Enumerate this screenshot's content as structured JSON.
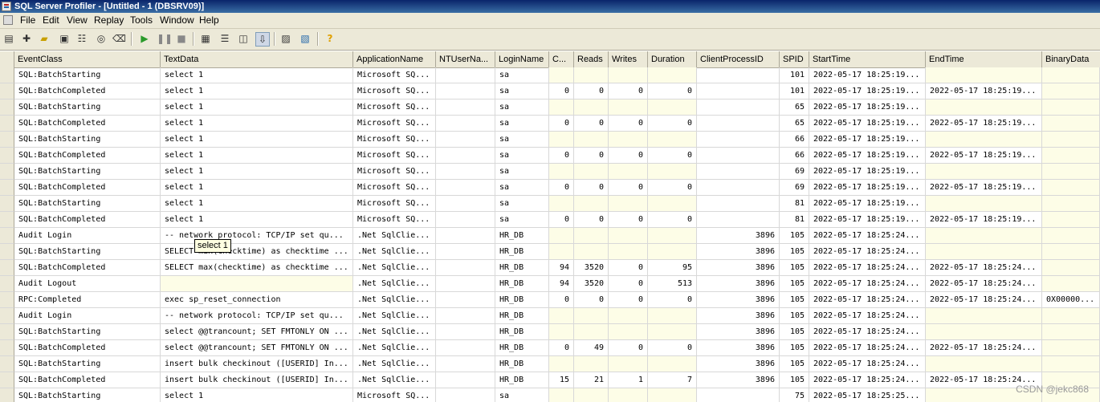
{
  "window": {
    "title": "SQL Server Profiler - [Untitled - 1 (DBSRV09)]"
  },
  "menu": [
    "File",
    "Edit",
    "View",
    "Replay",
    "Tools",
    "Window",
    "Help"
  ],
  "toolbar": {
    "icons": [
      "new-trace-icon",
      "new-template-icon",
      "open-icon",
      "save-icon",
      "properties-icon",
      "find-icon",
      "clear-trace-icon",
      "run-icon",
      "pause-icon",
      "stop-icon",
      "grid-view-icon",
      "columns-icon",
      "group-icon",
      "auto-scroll-icon",
      "activity-monitor-icon",
      "performance-monitor-icon",
      "help-icon"
    ]
  },
  "columns": [
    "EventClass",
    "TextData",
    "ApplicationName",
    "NTUserNa...",
    "LoginName",
    "C...",
    "Reads",
    "Writes",
    "Duration",
    "ClientProcessID",
    "SPID",
    "StartTime",
    "EndTime",
    "BinaryData"
  ],
  "rows": [
    [
      "SQL:BatchStarting",
      "select 1",
      "Microsoft SQ...",
      "",
      "sa",
      "",
      "",
      "",
      "",
      "",
      "101",
      "2022-05-17 18:25:19...",
      "",
      ""
    ],
    [
      "SQL:BatchCompleted",
      "select 1",
      "Microsoft SQ...",
      "",
      "sa",
      "0",
      "0",
      "0",
      "0",
      "",
      "101",
      "2022-05-17 18:25:19...",
      "2022-05-17 18:25:19...",
      ""
    ],
    [
      "SQL:BatchStarting",
      "select 1",
      "Microsoft SQ...",
      "",
      "sa",
      "",
      "",
      "",
      "",
      "",
      "65",
      "2022-05-17 18:25:19...",
      "",
      ""
    ],
    [
      "SQL:BatchCompleted",
      "select 1",
      "Microsoft SQ...",
      "",
      "sa",
      "0",
      "0",
      "0",
      "0",
      "",
      "65",
      "2022-05-17 18:25:19...",
      "2022-05-17 18:25:19...",
      ""
    ],
    [
      "SQL:BatchStarting",
      "select 1",
      "Microsoft SQ...",
      "",
      "sa",
      "",
      "",
      "",
      "",
      "",
      "66",
      "2022-05-17 18:25:19...",
      "",
      ""
    ],
    [
      "SQL:BatchCompleted",
      "select 1",
      "Microsoft SQ...",
      "",
      "sa",
      "0",
      "0",
      "0",
      "0",
      "",
      "66",
      "2022-05-17 18:25:19...",
      "2022-05-17 18:25:19...",
      ""
    ],
    [
      "SQL:BatchStarting",
      "select 1",
      "Microsoft SQ...",
      "",
      "sa",
      "",
      "",
      "",
      "",
      "",
      "69",
      "2022-05-17 18:25:19...",
      "",
      ""
    ],
    [
      "SQL:BatchCompleted",
      "select 1",
      "Microsoft SQ...",
      "",
      "sa",
      "0",
      "0",
      "0",
      "0",
      "",
      "69",
      "2022-05-17 18:25:19...",
      "2022-05-17 18:25:19...",
      ""
    ],
    [
      "SQL:BatchStarting",
      "select 1",
      "Microsoft SQ...",
      "",
      "sa",
      "",
      "",
      "",
      "",
      "",
      "81",
      "2022-05-17 18:25:19...",
      "",
      ""
    ],
    [
      "SQL:BatchCompleted",
      "select 1",
      "Microsoft SQ...",
      "",
      "sa",
      "0",
      "0",
      "0",
      "0",
      "",
      "81",
      "2022-05-17 18:25:19...",
      "2022-05-17 18:25:19...",
      ""
    ],
    [
      "Audit Login",
      "-- network protocol: TCP/IP  set qu...",
      ".Net SqlClie...",
      "",
      "HR_DB",
      "",
      "",
      "",
      "",
      "3896",
      "105",
      "2022-05-17 18:25:24...",
      "",
      ""
    ],
    [
      "SQL:BatchStarting",
      "SELECT max(checktime) as checktime ...",
      ".Net SqlClie...",
      "",
      "HR_DB",
      "",
      "",
      "",
      "",
      "3896",
      "105",
      "2022-05-17 18:25:24...",
      "",
      ""
    ],
    [
      "SQL:BatchCompleted",
      "SELECT max(checktime) as checktime ...",
      ".Net SqlClie...",
      "",
      "HR_DB",
      "94",
      "3520",
      "0",
      "95",
      "3896",
      "105",
      "2022-05-17 18:25:24...",
      "2022-05-17 18:25:24...",
      ""
    ],
    [
      "Audit Logout",
      "",
      ".Net SqlClie...",
      "",
      "HR_DB",
      "94",
      "3520",
      "0",
      "513",
      "3896",
      "105",
      "2022-05-17 18:25:24...",
      "2022-05-17 18:25:24...",
      ""
    ],
    [
      "RPC:Completed",
      "exec sp_reset_connection",
      ".Net SqlClie...",
      "",
      "HR_DB",
      "0",
      "0",
      "0",
      "0",
      "3896",
      "105",
      "2022-05-17 18:25:24...",
      "2022-05-17 18:25:24...",
      "0X00000..."
    ],
    [
      "Audit Login",
      "-- network protocol: TCP/IP  set qu...",
      ".Net SqlClie...",
      "",
      "HR_DB",
      "",
      "",
      "",
      "",
      "3896",
      "105",
      "2022-05-17 18:25:24...",
      "",
      ""
    ],
    [
      "SQL:BatchStarting",
      "select @@trancount; SET FMTONLY ON ...",
      ".Net SqlClie...",
      "",
      "HR_DB",
      "",
      "",
      "",
      "",
      "3896",
      "105",
      "2022-05-17 18:25:24...",
      "",
      ""
    ],
    [
      "SQL:BatchCompleted",
      "select @@trancount; SET FMTONLY ON ...",
      ".Net SqlClie...",
      "",
      "HR_DB",
      "0",
      "49",
      "0",
      "0",
      "3896",
      "105",
      "2022-05-17 18:25:24...",
      "2022-05-17 18:25:24...",
      ""
    ],
    [
      "SQL:BatchStarting",
      "insert bulk checkinout ([USERID] In...",
      ".Net SqlClie...",
      "",
      "HR_DB",
      "",
      "",
      "",
      "",
      "3896",
      "105",
      "2022-05-17 18:25:24...",
      "",
      ""
    ],
    [
      "SQL:BatchCompleted",
      "insert bulk checkinout ([USERID] In...",
      ".Net SqlClie...",
      "",
      "HR_DB",
      "15",
      "21",
      "1",
      "7",
      "3896",
      "105",
      "2022-05-17 18:25:24...",
      "2022-05-17 18:25:24...",
      ""
    ],
    [
      "SQL:BatchStarting",
      "select 1",
      "Microsoft SQ...",
      "",
      "sa",
      "",
      "",
      "",
      "",
      "",
      "75",
      "2022-05-17 18:25:25...",
      "",
      ""
    ]
  ],
  "tooltip": "select 1",
  "watermark": "CSDN @jekc868"
}
